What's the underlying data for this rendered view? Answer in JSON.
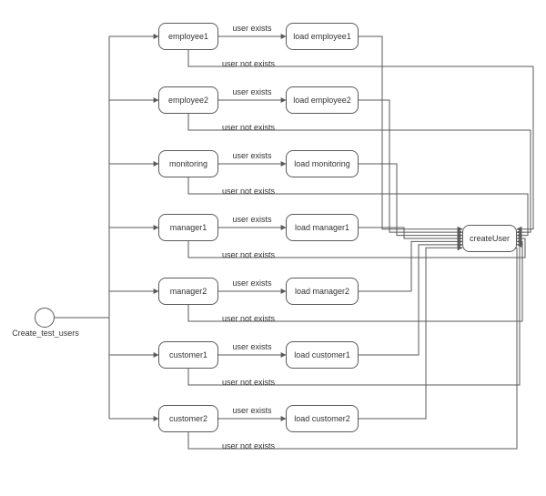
{
  "start": {
    "label": "Create_test_users"
  },
  "createUser": {
    "label": "createUser"
  },
  "rows": [
    {
      "check": "employee1",
      "load": "load employee1"
    },
    {
      "check": "employee2",
      "load": "load employee2"
    },
    {
      "check": "monitoring",
      "load": "load monitoring"
    },
    {
      "check": "manager1",
      "load": "load manager1"
    },
    {
      "check": "manager2",
      "load": "load manager2"
    },
    {
      "check": "customer1",
      "load": "load customer1"
    },
    {
      "check": "customer2",
      "load": "load customer2"
    }
  ],
  "labels": {
    "exists": "user exists",
    "not_exists": "user not exists"
  }
}
